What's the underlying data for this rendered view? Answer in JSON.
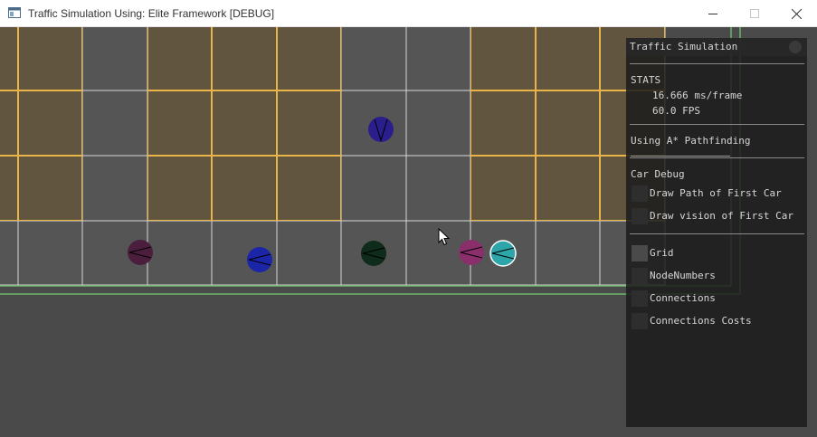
{
  "window": {
    "title": "Traffic Simulation Using: Elite Framework [DEBUG]",
    "app_icon": "app-window-icon",
    "controls": [
      "minimize-icon",
      "maximize-icon",
      "close-icon"
    ]
  },
  "colors": {
    "background": "#4a4a4a",
    "road_tile": "#555555",
    "building_tile": "#62553f",
    "grid_line": "#d8d8d8",
    "building_border": "#e9b448",
    "boundary_green": "#6ab46a",
    "panel_bg": "#1c1c1c",
    "panel_text": "#d6d6d6"
  },
  "scene": {
    "grid_columns": 10,
    "grid_rows": 4,
    "building_cells": [
      [
        0,
        0
      ],
      [
        2,
        0
      ],
      [
        3,
        0
      ],
      [
        4,
        0
      ],
      [
        7,
        0
      ],
      [
        8,
        0
      ],
      [
        9,
        0
      ],
      [
        0,
        1
      ],
      [
        2,
        1
      ],
      [
        3,
        1
      ],
      [
        4,
        1
      ],
      [
        7,
        1
      ],
      [
        8,
        1
      ],
      [
        9,
        1
      ],
      [
        0,
        2
      ],
      [
        2,
        2
      ],
      [
        3,
        2
      ],
      [
        4,
        2
      ],
      [
        7,
        2
      ],
      [
        8,
        2
      ],
      [
        9,
        2
      ]
    ],
    "cars": [
      {
        "id": "car-1",
        "color": "#2a1d8c",
        "heading": "down"
      },
      {
        "id": "car-2",
        "color": "#4a1e3c",
        "heading": "left"
      },
      {
        "id": "car-3",
        "color": "#1b25a8",
        "heading": "left"
      },
      {
        "id": "car-4",
        "color": "#0f2b1c",
        "heading": "left"
      },
      {
        "id": "car-5",
        "color": "#8a2f6b",
        "heading": "left"
      },
      {
        "id": "car-6",
        "color": "#2ea5a8",
        "heading": "left",
        "highlighted": true
      }
    ]
  },
  "panel": {
    "title": "Traffic Simulation",
    "stats_header": "STATS",
    "ms_per_frame": "16.666 ms/frame",
    "fps": "60.0 FPS",
    "pathfinding": "Using A* Pathfinding",
    "car_debug_header": "Car Debug",
    "checkboxes": [
      {
        "label": "Draw Path of First Car",
        "checked": false
      },
      {
        "label": "Draw vision of First Car",
        "checked": false
      },
      {
        "label": "Grid",
        "checked": true
      },
      {
        "label": "NodeNumbers",
        "checked": false
      },
      {
        "label": "Connections",
        "checked": false
      },
      {
        "label": "Connections Costs",
        "checked": false
      }
    ]
  },
  "cursor": "mouse-pointer-icon"
}
